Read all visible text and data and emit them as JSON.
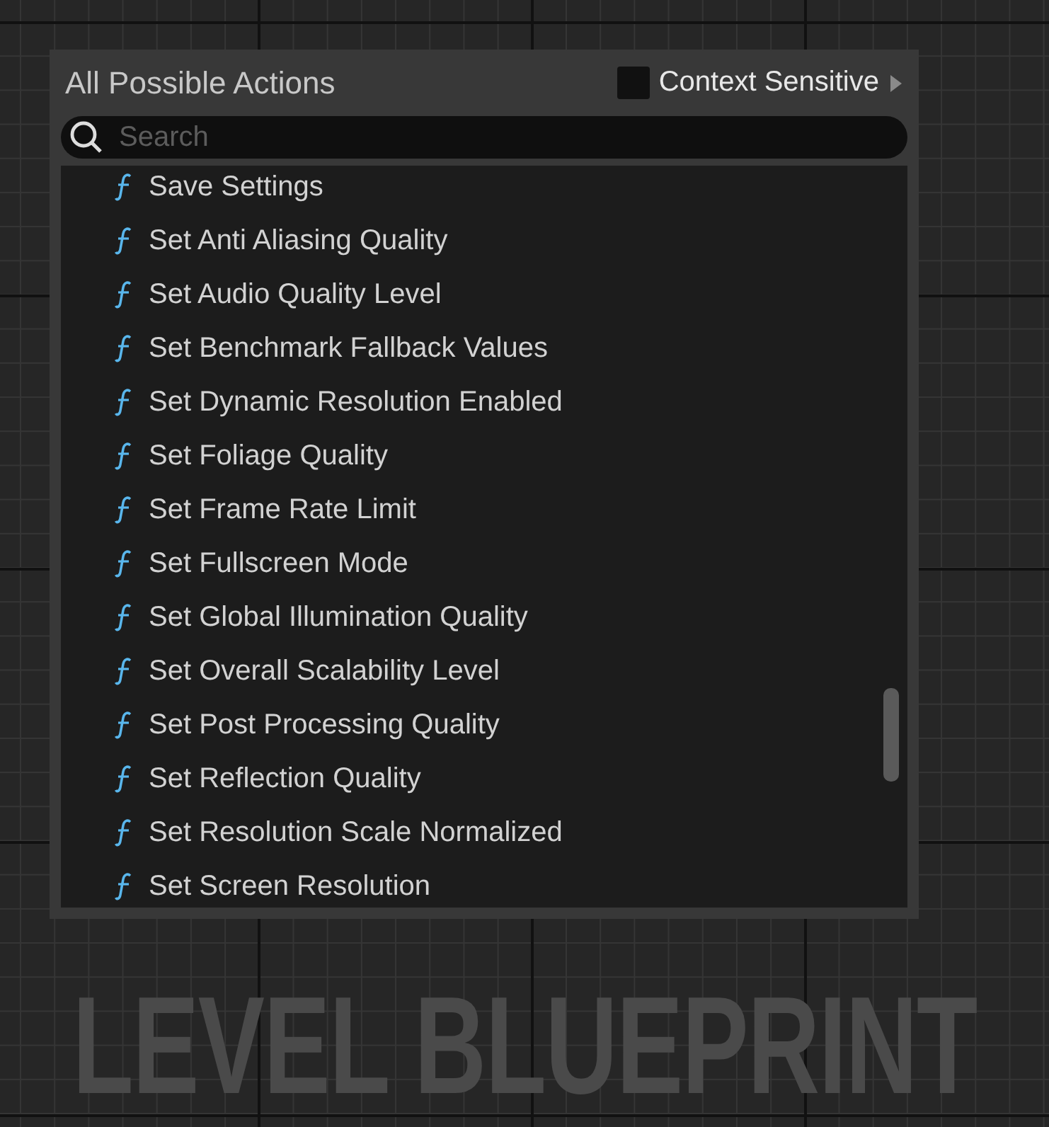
{
  "menu": {
    "title": "All Possible Actions",
    "context_sensitive": {
      "label": "Context Sensitive",
      "checked": false
    }
  },
  "search": {
    "placeholder": "Search"
  },
  "actions": [
    {
      "label": "Save Settings",
      "kind": "function"
    },
    {
      "label": "Set Anti Aliasing Quality",
      "kind": "function"
    },
    {
      "label": "Set Audio Quality Level",
      "kind": "function"
    },
    {
      "label": "Set Benchmark Fallback Values",
      "kind": "function"
    },
    {
      "label": "Set Dynamic Resolution Enabled",
      "kind": "function"
    },
    {
      "label": "Set Foliage Quality",
      "kind": "function"
    },
    {
      "label": "Set Frame Rate Limit",
      "kind": "function"
    },
    {
      "label": "Set Fullscreen Mode",
      "kind": "function"
    },
    {
      "label": "Set Global Illumination Quality",
      "kind": "function"
    },
    {
      "label": "Set Overall Scalability Level",
      "kind": "function"
    },
    {
      "label": "Set Post Processing Quality",
      "kind": "function"
    },
    {
      "label": "Set Reflection Quality",
      "kind": "function"
    },
    {
      "label": "Set Resolution Scale Normalized",
      "kind": "function"
    },
    {
      "label": "Set Screen Resolution",
      "kind": "function"
    }
  ],
  "graph_label": "LEVEL BLUEPRINT"
}
